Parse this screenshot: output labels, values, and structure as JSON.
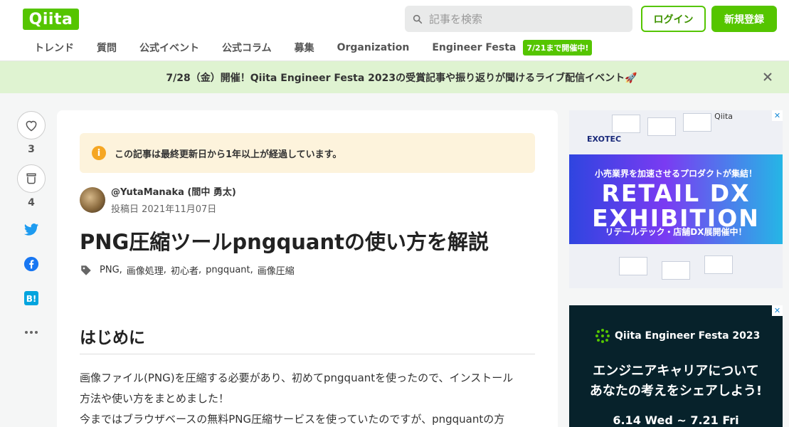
{
  "header": {
    "logo": "Qiita",
    "search_placeholder": "記事を検索",
    "login_label": "ログイン",
    "signup_label": "新規登録",
    "nav": [
      "トレンド",
      "質問",
      "公式イベント",
      "公式コラム",
      "募集",
      "Organization",
      "Engineer Festa"
    ],
    "nav_badge": "7/21まで開催中!"
  },
  "banner": {
    "text": "7/28（金）開催！Qiita Engineer Festa 2023の受賞記事や振り返りが聞けるライブ配信イベント🚀"
  },
  "actions": {
    "like_count": "3",
    "stock_count": "4"
  },
  "article": {
    "alert": "この記事は最終更新日から1年以上が経過しています。",
    "author": "@YutaManaka (間中 勇太)",
    "posted": "投稿日 2021年11月07日",
    "title": "PNG圧縮ツールpngquantの使い方を解説",
    "tags": [
      "PNG",
      "画像処理",
      "初心者",
      "pngquant",
      "画像圧縮"
    ],
    "heading": "はじめに",
    "body": [
      "画像ファイル(PNG)を圧縮する必要があり、初めてpngquantを使ったので、インストール",
      "方法や使い方をまとめました！",
      "今まではブラウザベースの無料PNG圧縮サービスを使っていたのですが、pngquantの方"
    ]
  },
  "ads": {
    "ad1_brand": "EXOTEC",
    "ad1_qiita": "Qiita",
    "ad1_sub": "小売業界を加速させるプロダクトが集結！",
    "ad1_main1": "RETAIL DX",
    "ad1_main2": "EXHIBITION",
    "ad1_caption": "リテールテック・店舗DX展開催中！",
    "ad2_brand": "Qiita Engineer Festa 2023",
    "ad2_line1": "エンジニアキャリアについて",
    "ad2_line2": "あなたの考えをシェアしよう!",
    "ad2_date": "6.14 Wed ~ 7.21 Fri"
  },
  "colors": {
    "brand": "#55c500",
    "banner_bg": "#dff3d1",
    "alert_bg": "#fdf3dc"
  }
}
